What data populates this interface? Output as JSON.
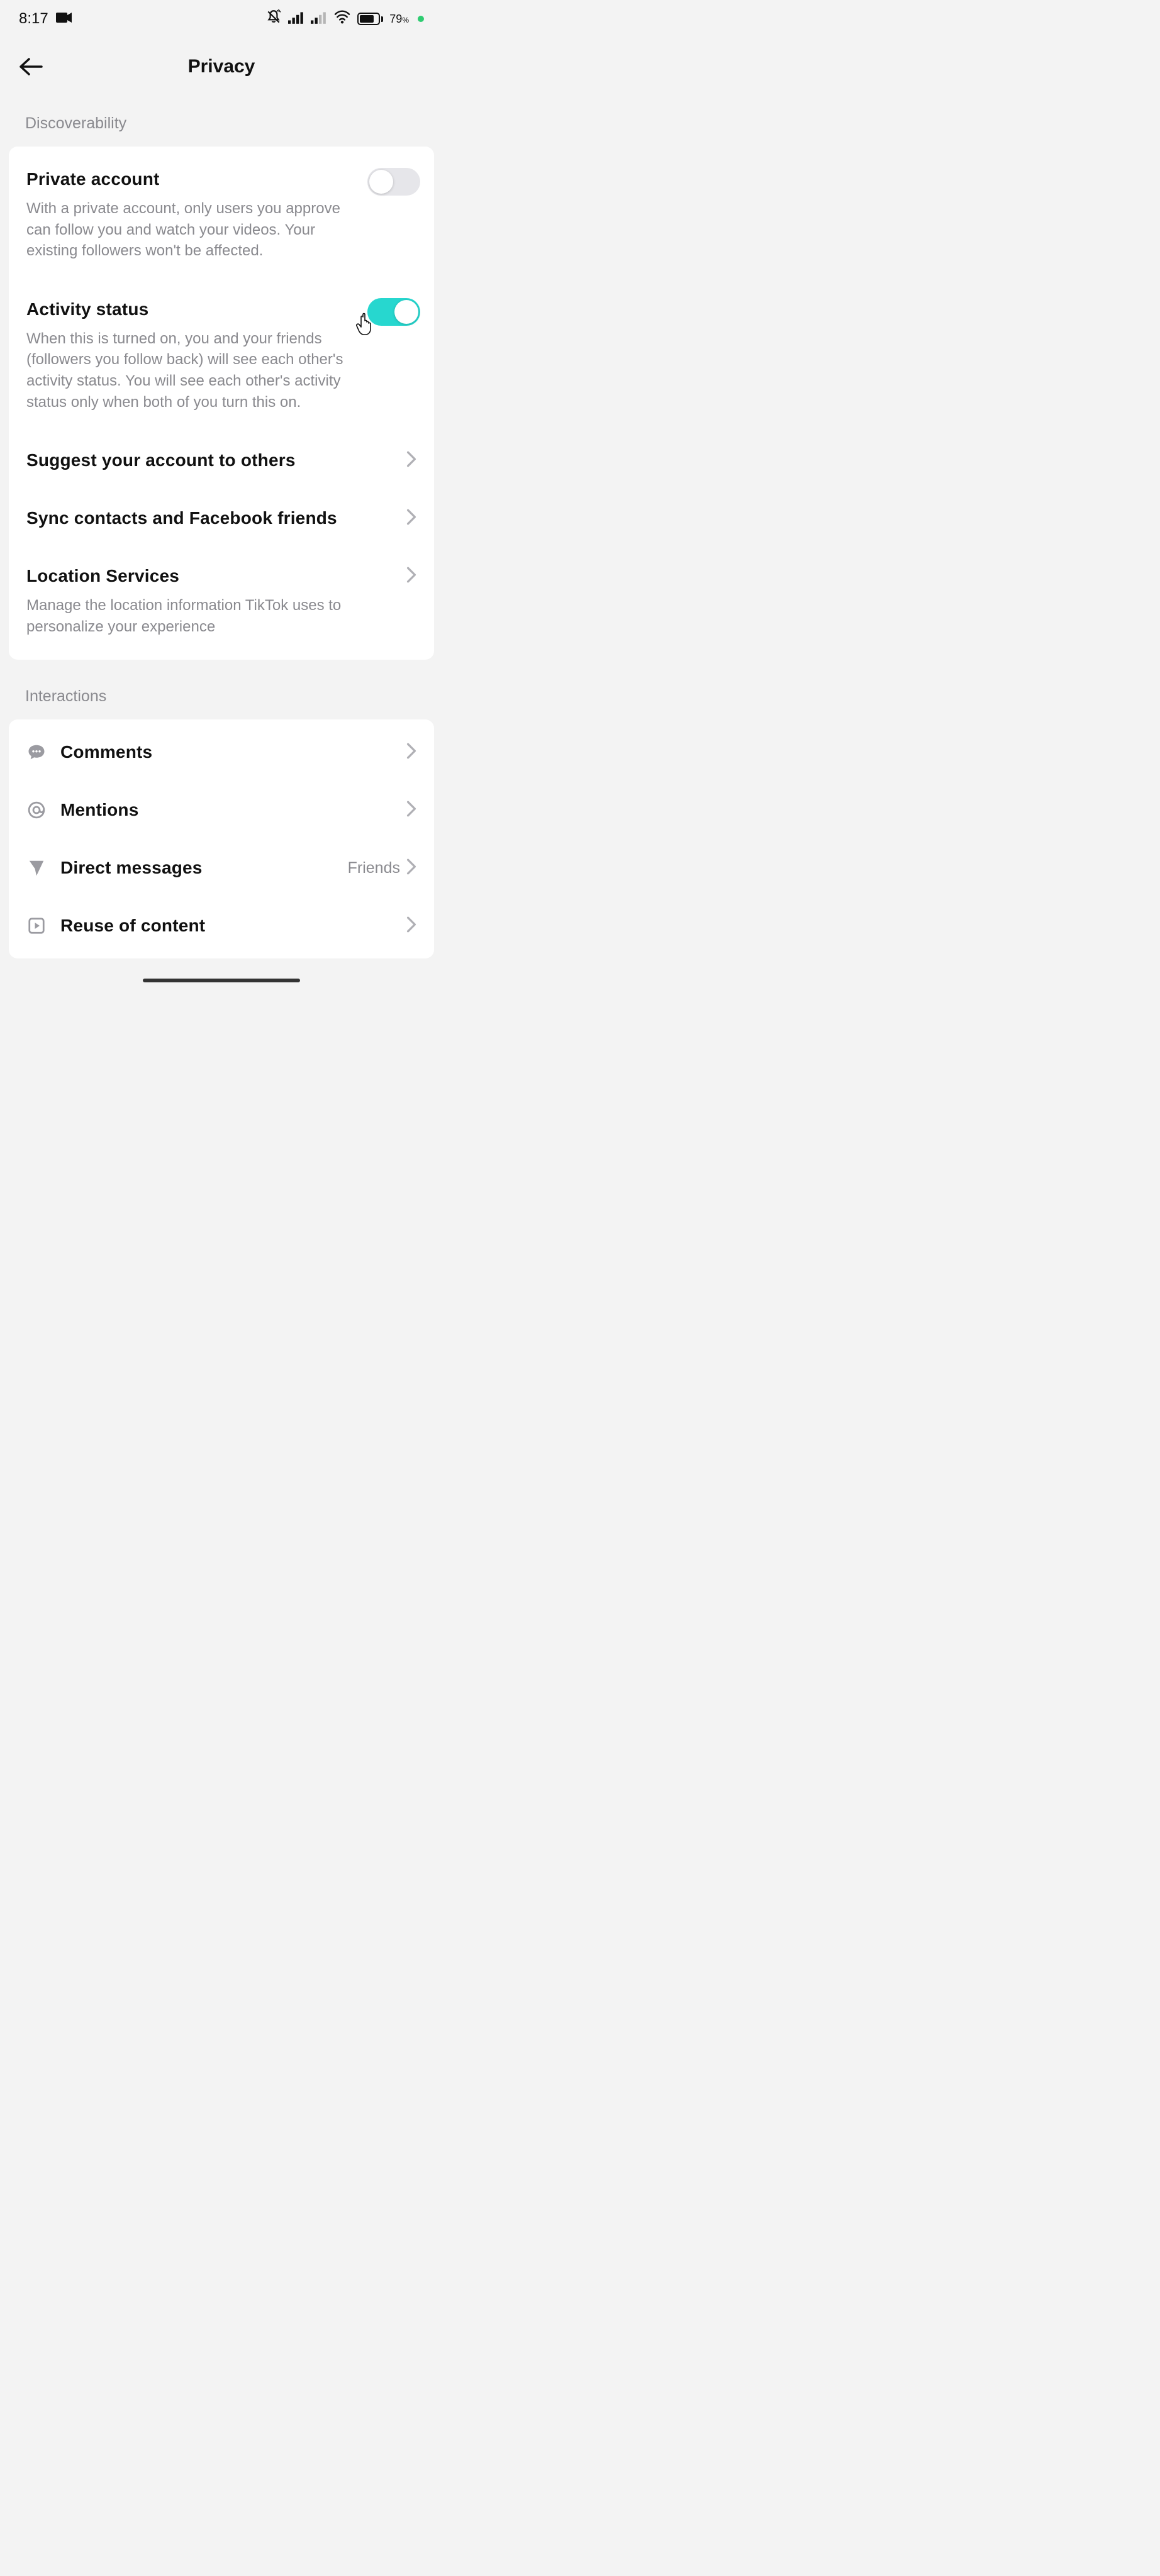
{
  "status": {
    "time": "8:17",
    "battery_pct": "79"
  },
  "header": {
    "title": "Privacy"
  },
  "sections": {
    "discoverability": {
      "header": "Discoverability",
      "private_account": {
        "title": "Private account",
        "desc": "With a private account, only users you approve can follow you and watch your videos. Your existing followers won't be affected.",
        "on": false
      },
      "activity_status": {
        "title": "Activity status",
        "desc": "When this is turned on, you and your friends (followers you follow back) will see each other's activity status. You will see each other's activity status only when both of you turn this on.",
        "on": true
      },
      "suggest": {
        "title": "Suggest your account to others"
      },
      "sync": {
        "title": "Sync contacts and Facebook friends"
      },
      "location": {
        "title": "Location Services",
        "desc": "Manage the location information TikTok uses to personalize your experience"
      }
    },
    "interactions": {
      "header": "Interactions",
      "comments": {
        "title": "Comments"
      },
      "mentions": {
        "title": "Mentions"
      },
      "direct_messages": {
        "title": "Direct messages",
        "value": "Friends"
      },
      "reuse": {
        "title": "Reuse of content"
      }
    }
  }
}
